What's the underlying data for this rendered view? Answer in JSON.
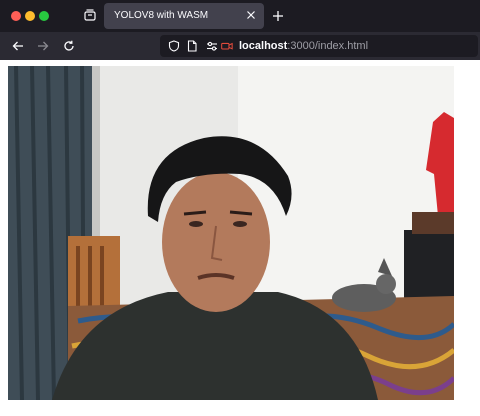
{
  "browser": {
    "tab_title": "YOLOV8 with WASM",
    "url_host": "localhost",
    "url_path": ":3000/index.html"
  },
  "icons": {
    "window": [
      "close-window-button",
      "minimize-window-button",
      "maximize-window-button"
    ],
    "toolbar": [
      "tab-manager-icon",
      "close-icon",
      "plus-icon",
      "back-arrow-icon",
      "forward-arrow-icon",
      "reload-icon"
    ],
    "urlbar": [
      "shield-icon",
      "page-icon",
      "permissions-icon",
      "camera-icon"
    ]
  },
  "colors": {
    "chrome_dark": "#1c1b22",
    "toolbar": "#2b2a33",
    "tab_active": "#42414d",
    "camera_indicator": "#e24b3c"
  }
}
